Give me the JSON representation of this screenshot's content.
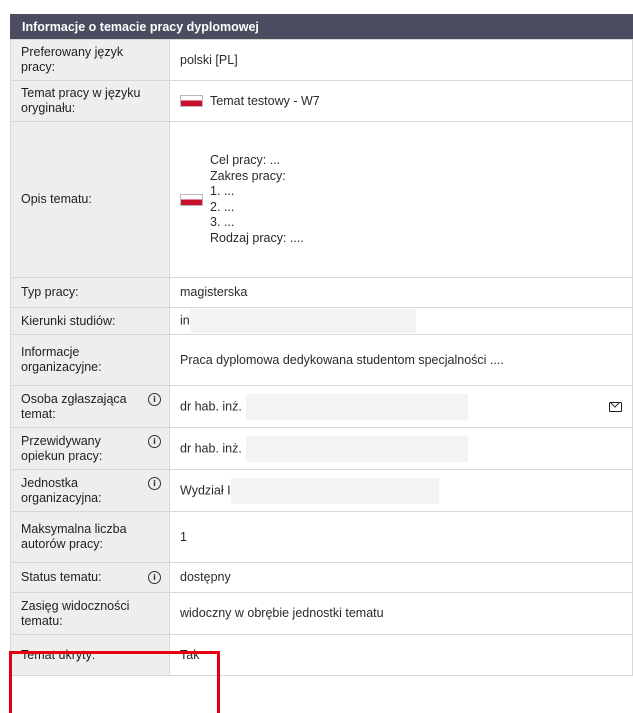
{
  "header": {
    "title": "Informacje o temacie pracy dyplomowej"
  },
  "rows": {
    "language": {
      "label": "Preferowany język pracy:",
      "value": "polski [PL]"
    },
    "title": {
      "label": "Temat pracy w języku oryginału:",
      "value": "Temat testowy - W7",
      "flag_icon": "pl-flag-icon"
    },
    "description": {
      "label": "Opis tematu:",
      "lines": [
        "Cel pracy: ...",
        "Zakres pracy:",
        "1. ...",
        "2. ...",
        "3. ...",
        "Rodzaj pracy: ...."
      ],
      "flag_icon": "pl-flag-icon"
    },
    "type": {
      "label": "Typ pracy:",
      "value": "magisterska"
    },
    "fields": {
      "label": "Kierunki studiów:",
      "value": "in"
    },
    "org_info": {
      "label": "Informacje organizacyjne:",
      "value": "Praca dyplomowa dedykowana studentom specjalności ...."
    },
    "proposer": {
      "label": "Osoba zgłaszająca temat:",
      "value": "dr hab. inż.",
      "info_icon": "info-icon",
      "action_icon": "mail-icon"
    },
    "supervisor": {
      "label": "Przewidywany opiekun pracy:",
      "value": "dr hab. inż.",
      "info_icon": "info-icon"
    },
    "unit": {
      "label": "Jednostka organizacyjna:",
      "value": "Wydział I",
      "info_icon": "info-icon"
    },
    "max_authors": {
      "label": "Maksymalna liczba autorów pracy:",
      "value": "1"
    },
    "status": {
      "label": "Status tematu:",
      "value": "dostępny",
      "info_icon": "info-icon"
    },
    "visibility": {
      "label": "Zasięg widoczności tematu:",
      "value": "widoczny w obrębie jednostki tematu"
    },
    "hidden": {
      "label": "Temat ukryty:",
      "value": "Tak"
    }
  },
  "colors": {
    "header_bg": "#4a4c5f",
    "label_bg": "#eeeeee",
    "highlight": "#e3000f"
  }
}
